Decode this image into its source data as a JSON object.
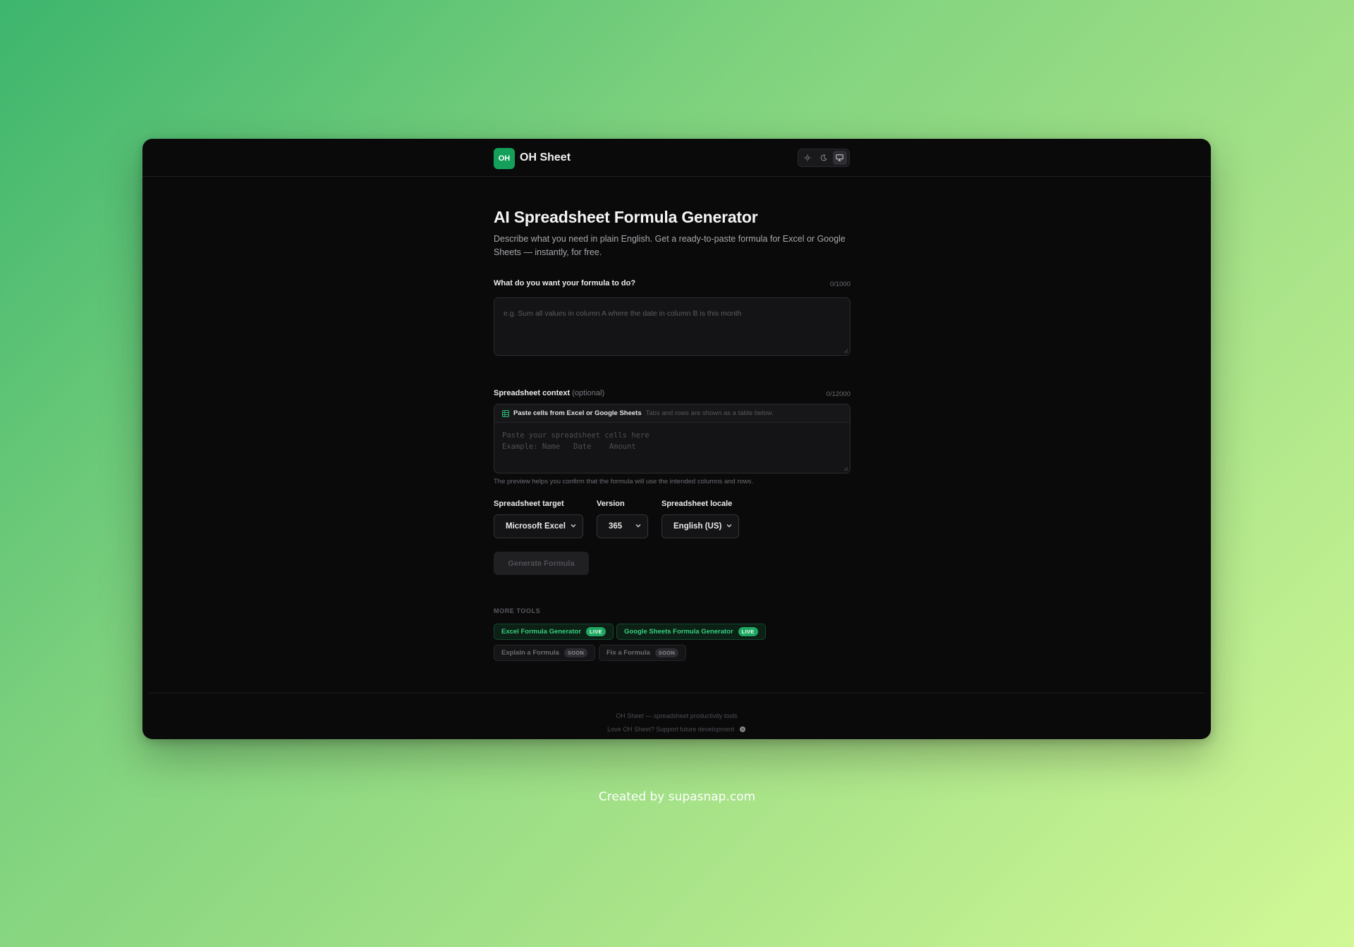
{
  "app": {
    "logo_text": "OH",
    "brand": "OH Sheet",
    "theme_options": [
      "light",
      "dark",
      "system"
    ],
    "active_theme": "system"
  },
  "main": {
    "title": "AI Spreadsheet Formula Generator",
    "description": "Describe what you need in plain English. Get a ready-to-paste formula for Excel or Google Sheets — instantly, for free.",
    "prompt": {
      "label": "What do you want your formula to do?",
      "counter": "0/1000",
      "value": "",
      "placeholder": "e.g. Sum all values in column A where the date in column B is this month"
    },
    "context": {
      "label": "Spreadsheet context",
      "optional": "(optional)",
      "counter": "0/12000",
      "paste_title": "Paste cells from Excel or Google Sheets",
      "paste_hint": "Tabs and rows are shown as a table below.",
      "value": "",
      "placeholder": "Paste your spreadsheet cells here\nExample: Name   Date    Amount",
      "helper": "The preview helps you confirm that the formula will use the intended columns and rows."
    },
    "target": {
      "label": "Spreadsheet target",
      "value": "Microsoft Excel"
    },
    "version": {
      "label": "Version",
      "value": "365"
    },
    "locale": {
      "label": "Spreadsheet locale",
      "value": "English (US)"
    },
    "generate_button": "Generate Formula"
  },
  "more_tools": {
    "label": "MORE TOOLS",
    "items": [
      {
        "label": "Excel Formula Generator",
        "badge": "LIVE"
      },
      {
        "label": "Google Sheets Formula Generator",
        "badge": "LIVE"
      },
      {
        "label": "Explain a Formula",
        "badge": "SOON"
      },
      {
        "label": "Fix a Formula",
        "badge": "SOON"
      }
    ]
  },
  "footer": {
    "line1": "OH Sheet — spreadsheet productivity tools",
    "line2": "Love OH Sheet? Support future development"
  },
  "credit": "Created by supasnap.com",
  "colors": {
    "accent": "#14a05b",
    "live_text": "#35d07f",
    "app_background": "#0a0a0b"
  }
}
